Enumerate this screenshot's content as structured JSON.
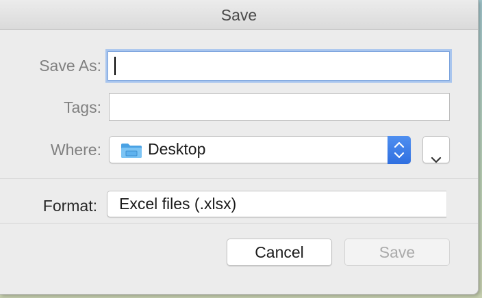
{
  "dialog": {
    "title": "Save",
    "save_as": {
      "label": "Save As:",
      "value": ""
    },
    "tags": {
      "label": "Tags:",
      "value": ""
    },
    "where": {
      "label": "Where:",
      "value": "Desktop",
      "icon": "folder-icon"
    },
    "format": {
      "label": "Format:",
      "value": "Excel files (.xlsx)"
    },
    "buttons": {
      "cancel": "Cancel",
      "save": "Save"
    }
  },
  "colors": {
    "focus_ring": "#a8c5ee",
    "stepper_blue": "#3a7ae6",
    "folder_blue": "#5fb2ee"
  }
}
